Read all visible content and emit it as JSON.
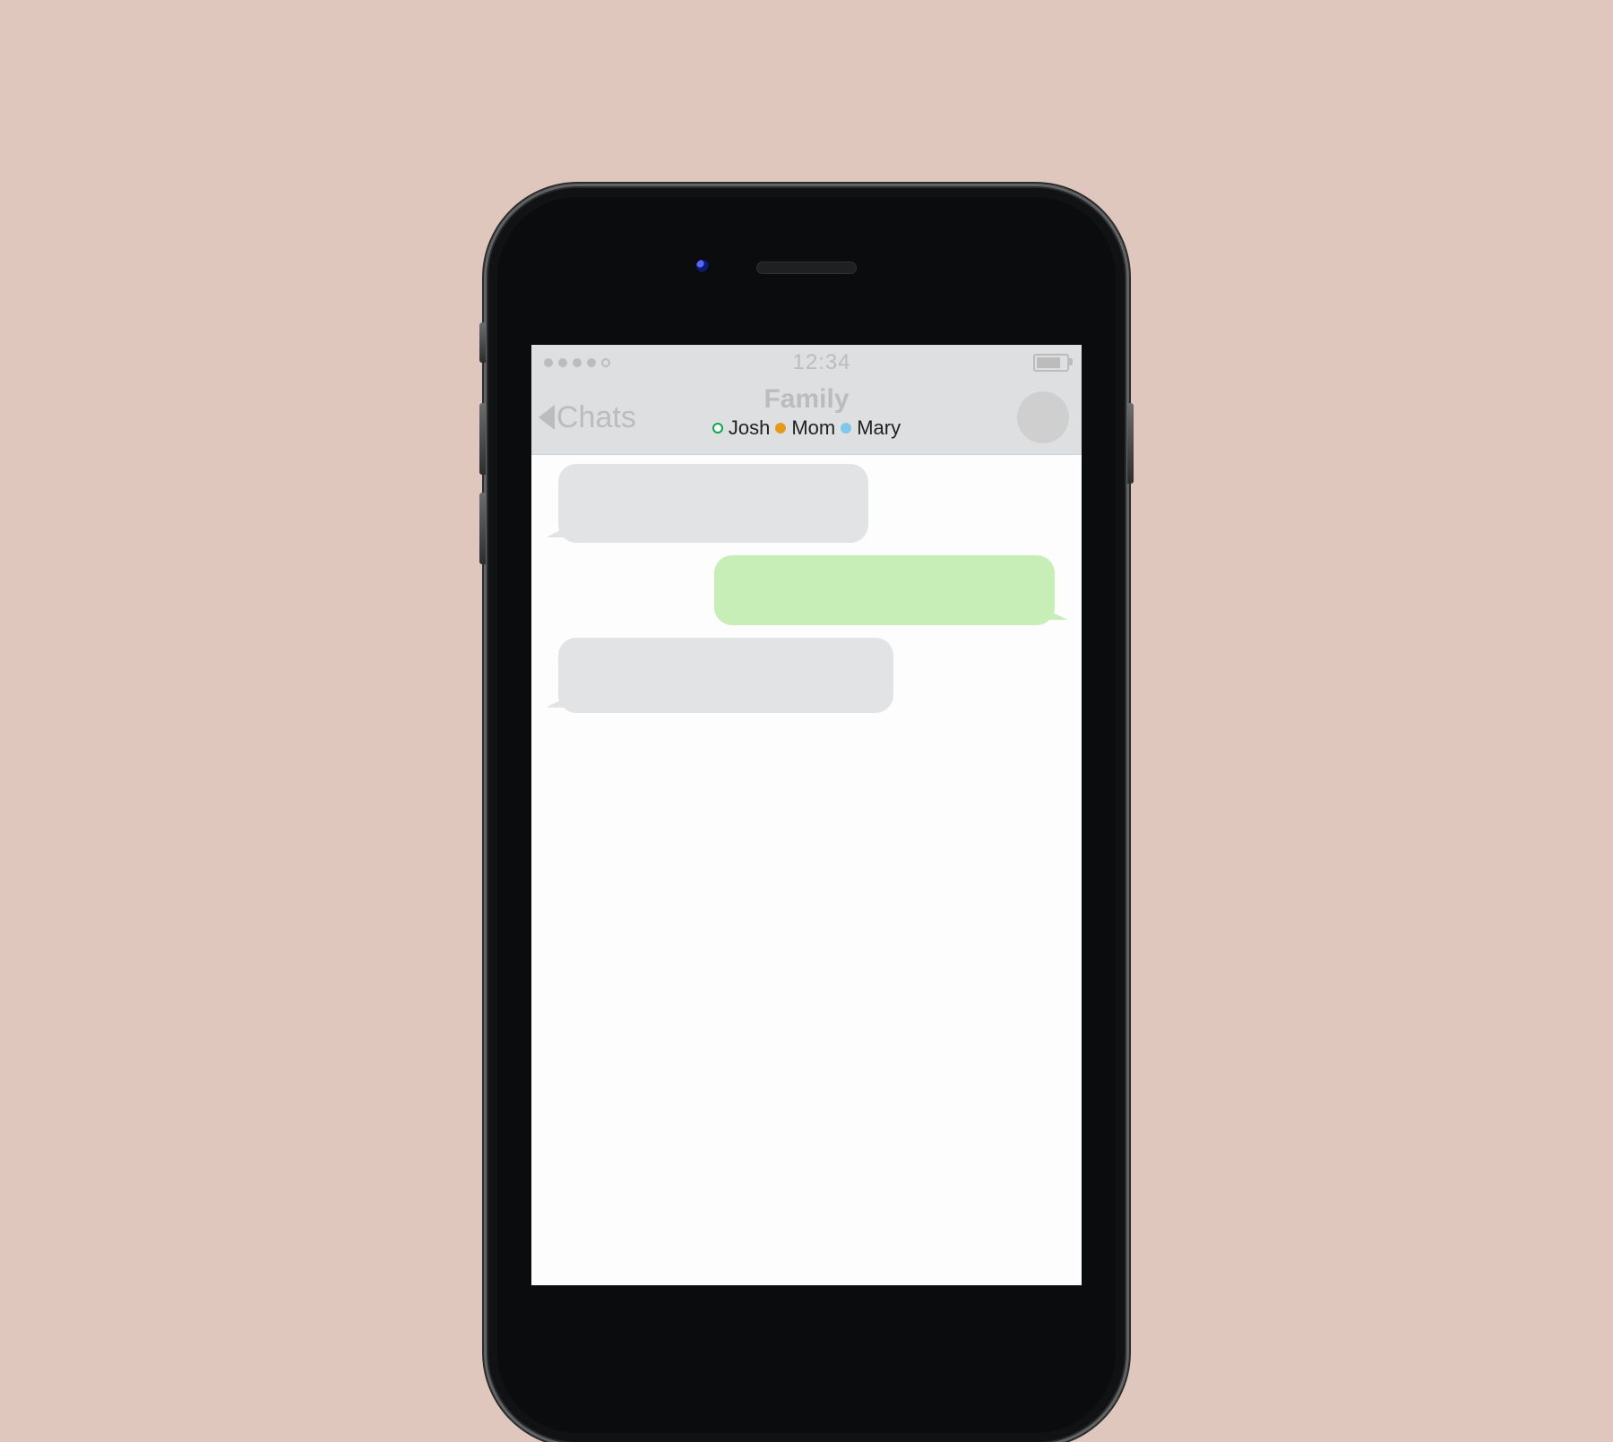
{
  "statusbar": {
    "signal_dots": 5,
    "signal_filled": 4,
    "time": "12:34"
  },
  "header": {
    "back_label": "Chats",
    "title": "Family",
    "members": [
      {
        "name": "Josh",
        "dot_style": "ring",
        "dot_color": "#0aa64a"
      },
      {
        "name": "Mom",
        "dot_style": "solid",
        "dot_color": "#e49a1b"
      },
      {
        "name": "Mary",
        "dot_style": "solid",
        "dot_color": "#7fc8ea"
      }
    ]
  },
  "thread": {
    "messages": [
      {
        "direction": "in",
        "text": ""
      },
      {
        "direction": "out",
        "text": ""
      },
      {
        "direction": "in",
        "text": ""
      }
    ]
  }
}
